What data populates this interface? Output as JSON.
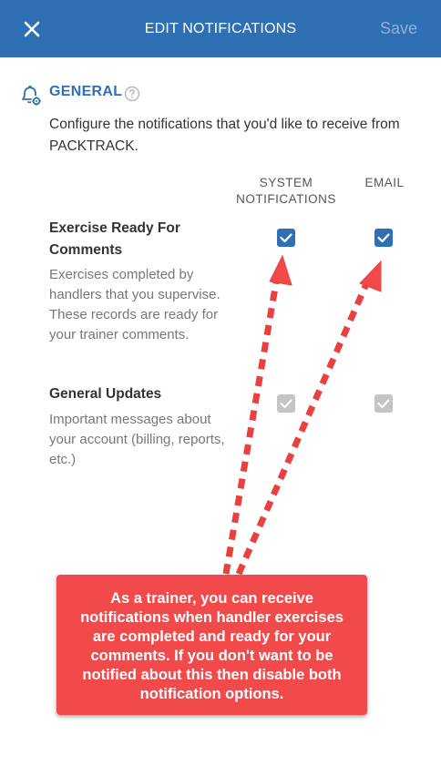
{
  "header": {
    "title": "EDIT NOTIFICATIONS",
    "save_label": "Save",
    "close_icon": "close-icon"
  },
  "section": {
    "title": "GENERAL",
    "icon": "bell-settings-icon",
    "help_icon": "help-circle-icon",
    "description": "Configure the notifications that you'd like to receive from PACKTRACK."
  },
  "columns": {
    "system_line1": "SYSTEM",
    "system_line2": "NOTIFICATIONS",
    "email": "EMAIL"
  },
  "preferences": [
    {
      "title": "Exercise Ready For Comments",
      "description": "Exercises completed by handlers that you supervise. These records are ready for your trainer comments.",
      "system_checked": true,
      "email_checked": true,
      "editable": true
    },
    {
      "title": "General Updates",
      "description": "Important messages about your account (billing, reports, etc.)",
      "system_checked": true,
      "email_checked": true,
      "editable": false
    }
  ],
  "callout": {
    "text": "As a trainer, you can receive notifications when handler exercises are completed and ready for your comments. If you don't want to be notified about this then disable both notification options."
  },
  "colors": {
    "primary": "#2f6fb3",
    "save_disabled": "#8fb1d6",
    "callout": "#f24a4a",
    "checkbox_disabled": "#c4c4c4"
  }
}
